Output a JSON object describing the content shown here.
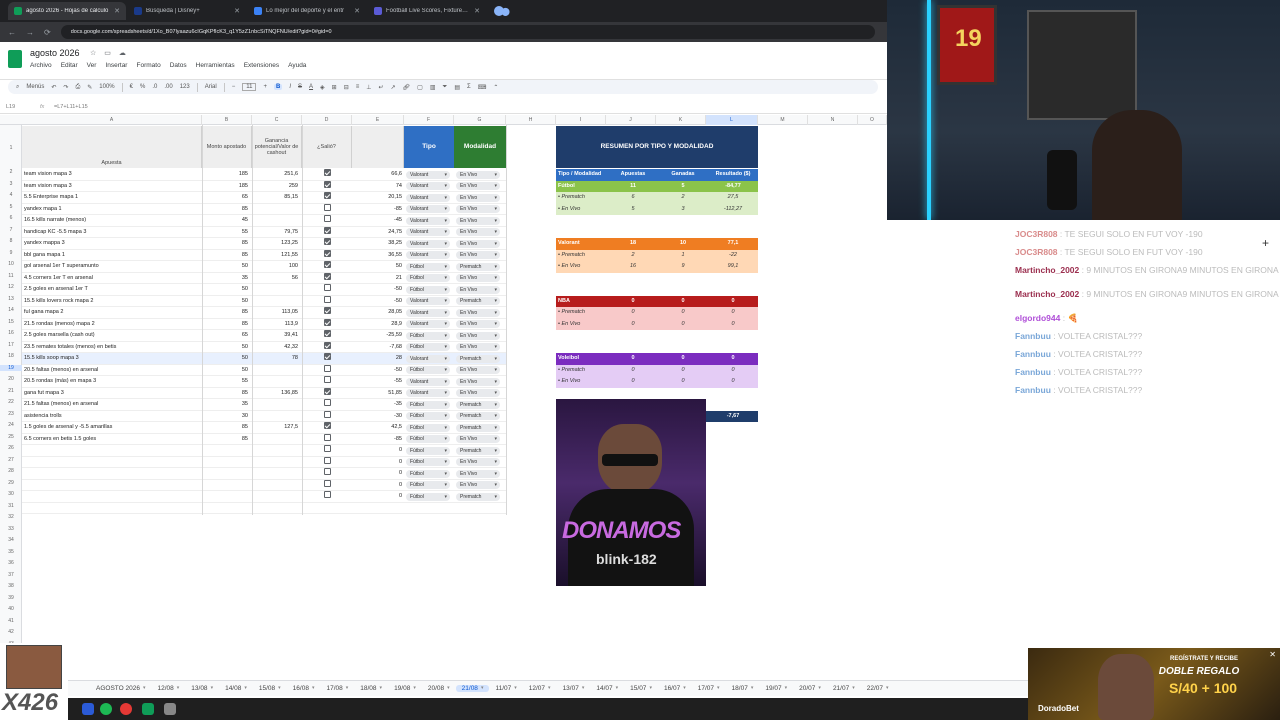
{
  "browser": {
    "tabs": [
      {
        "title": "agosto 2026 - Hojas de cálculo",
        "color": "#0f9d58",
        "active": true
      },
      {
        "title": "Búsqueda | Disney+",
        "color": "#1a3a8a",
        "active": false
      },
      {
        "title": "Lo mejor del deporte y el entr",
        "color": "#3b82f6",
        "active": false
      },
      {
        "title": "Football Live Scores, Fixtures &",
        "color": "#5b5bd6",
        "active": false
      }
    ],
    "url": "docs.google.com/spreadsheets/d/1Xo_B07lyaazu6cIGqKPfIcK3_q1Y5zZ1nbcSiTNQFNU/edit?gid=0#gid=0"
  },
  "sheets": {
    "doc_title": "agosto 2026",
    "menus": [
      "Archivo",
      "Editar",
      "Ver",
      "Insertar",
      "Formato",
      "Datos",
      "Herramientas",
      "Extensiones",
      "Ayuda"
    ],
    "toolbar": {
      "menus_label": "Menús",
      "zoom": "100%",
      "currency": "€",
      "percent": "%",
      "dec_dec": ".0",
      "dec_inc": ".00",
      "num_fmt": "123",
      "font": "Arial",
      "font_size": "11"
    },
    "formula": {
      "name_box": "L19",
      "content": "=L7+L11+L15"
    },
    "columns": [
      "A",
      "B",
      "C",
      "D",
      "E",
      "F",
      "G",
      "H",
      "I",
      "J",
      "K",
      "L",
      "M",
      "N",
      "O"
    ],
    "headers": {
      "apuesta": "Apuesta",
      "monto": "Monto apostado",
      "ganancia": "Ganancia potencial/Valor de cashout",
      "salio": "¿Salió?",
      "tipo": "Tipo",
      "modalidad": "Modalidad"
    },
    "rows": [
      {
        "n": "2",
        "a": "team vision mapa 3",
        "b": "185",
        "c": "251,6",
        "d": true,
        "e": "66,6",
        "f": "Valorant",
        "g": "En Vivo"
      },
      {
        "n": "3",
        "a": "team vision mapa 3",
        "b": "185",
        "c": "259",
        "d": true,
        "e": "74",
        "f": "Valorant",
        "g": "En Vivo"
      },
      {
        "n": "5",
        "a": "5.5 Enterprise mapa 1",
        "b": "65",
        "c": "85,15",
        "d": true,
        "e": "20,15",
        "f": "Valorant",
        "g": "En Vivo"
      },
      {
        "n": "6",
        "a": "yandex mapa 1",
        "b": "85",
        "c": "",
        "d": false,
        "e": "-85",
        "f": "Valorant",
        "g": "En Vivo"
      },
      {
        "n": "7",
        "a": "16.5 kills narrate (menos)",
        "b": "45",
        "c": "",
        "d": false,
        "e": "-45",
        "f": "Valorant",
        "g": "En Vivo"
      },
      {
        "n": "8",
        "a": "handicap KC -5.5 mapa 3",
        "b": "55",
        "c": "79,75",
        "d": true,
        "e": "24,75",
        "f": "Valorant",
        "g": "En Vivo"
      },
      {
        "n": "9",
        "a": "yandex mappa 3",
        "b": "85",
        "c": "123,25",
        "d": true,
        "e": "38,25",
        "f": "Valorant",
        "g": "En Vivo"
      },
      {
        "n": "10",
        "a": "bbl gana mapa 1",
        "b": "85",
        "c": "121,55",
        "d": true,
        "e": "36,55",
        "f": "Valorant",
        "g": "En Vivo"
      },
      {
        "n": "11",
        "a": "gol arsenal 1er T superamunto",
        "b": "50",
        "c": "100",
        "d": true,
        "e": "50",
        "f": "Fútbol",
        "g": "Prematch"
      },
      {
        "n": "12",
        "a": "4.5 corners 1er T en arsenal",
        "b": "35",
        "c": "56",
        "d": true,
        "e": "21",
        "f": "Fútbol",
        "g": "En Vivo"
      },
      {
        "n": "13",
        "a": "2.5 goles en arsenal 1er T",
        "b": "50",
        "c": "",
        "d": false,
        "e": "-50",
        "f": "Fútbol",
        "g": "En Vivo"
      },
      {
        "n": "14",
        "a": "15.5 kills lovers rock mapa 2",
        "b": "50",
        "c": "",
        "d": false,
        "e": "-50",
        "f": "Valorant",
        "g": "Prematch"
      },
      {
        "n": "15",
        "a": "ful gana mapa 2",
        "b": "85",
        "c": "113,05",
        "d": true,
        "e": "28,05",
        "f": "Valorant",
        "g": "En Vivo"
      },
      {
        "n": "16",
        "a": "21.5 rondas (menos) mapa 2",
        "b": "85",
        "c": "113,9",
        "d": true,
        "e": "28,9",
        "f": "Valorant",
        "g": "En Vivo"
      },
      {
        "n": "17",
        "a": "2.5 goles marsella (cash out)",
        "b": "65",
        "c": "39,41",
        "d": true,
        "e": "-25,59",
        "f": "Fútbol",
        "g": "En Vivo"
      },
      {
        "n": "18",
        "a": "23.5 remates totales (menos) en betis",
        "b": "50",
        "c": "42,32",
        "d": true,
        "e": "-7,68",
        "f": "Fútbol",
        "g": "En Vivo"
      },
      {
        "n": "19",
        "a": "15.5 kills soop mapa 3",
        "b": "50",
        "c": "78",
        "d": true,
        "e": "28",
        "f": "Valorant",
        "g": "Prematch"
      },
      {
        "n": "20",
        "a": "20.5 faltas (menos) en arsenal",
        "b": "50",
        "c": "",
        "d": false,
        "e": "-50",
        "f": "Fútbol",
        "g": "En Vivo"
      },
      {
        "n": "21",
        "a": "20.5 rondas (más) en mapa 3",
        "b": "55",
        "c": "",
        "d": false,
        "e": "-55",
        "f": "Valorant",
        "g": "En Vivo"
      },
      {
        "n": "22",
        "a": "gana fut mapa 3",
        "b": "85",
        "c": "136,85",
        "d": true,
        "e": "51,85",
        "f": "Valorant",
        "g": "En Vivo"
      },
      {
        "n": "23",
        "a": "21.5 faltas (menos) en arsenal",
        "b": "35",
        "c": "",
        "d": false,
        "e": "-35",
        "f": "Fútbol",
        "g": "Prematch"
      },
      {
        "n": "24",
        "a": "asistencia trolls",
        "b": "30",
        "c": "",
        "d": false,
        "e": "-30",
        "f": "Fútbol",
        "g": "Prematch"
      },
      {
        "n": "25",
        "a": "1.5 goles de arsenal y -5.5 amarillas",
        "b": "85",
        "c": "127,5",
        "d": true,
        "e": "42,5",
        "f": "Fútbol",
        "g": "Prematch"
      },
      {
        "n": "26",
        "a": "6.5 corners en betis 1.5 goles",
        "b": "85",
        "c": "",
        "d": false,
        "e": "-85",
        "f": "Fútbol",
        "g": "En Vivo"
      },
      {
        "n": "27",
        "a": "",
        "b": "",
        "c": "",
        "d": false,
        "e": "0",
        "f": "Fútbol",
        "g": "Prematch"
      },
      {
        "n": "28",
        "a": "",
        "b": "",
        "c": "",
        "d": false,
        "e": "0",
        "f": "Fútbol",
        "g": "En Vivo"
      },
      {
        "n": "29",
        "a": "",
        "b": "",
        "c": "",
        "d": false,
        "e": "0",
        "f": "Fútbol",
        "g": "En Vivo"
      },
      {
        "n": "30",
        "a": "",
        "b": "",
        "c": "",
        "d": false,
        "e": "0",
        "f": "Fútbol",
        "g": "En Vivo"
      },
      {
        "n": "31",
        "a": "",
        "b": "",
        "c": "",
        "d": false,
        "e": "0",
        "f": "Fútbol",
        "g": "Prematch"
      }
    ],
    "summary": {
      "title": "RESUMEN POR TIPO Y MODALIDAD",
      "headers": [
        "Tipo / Modalidad",
        "Apuestas",
        "Ganadas",
        "Resultado ($)"
      ],
      "rows": [
        {
          "label": "Fútbol",
          "v": [
            "11",
            "5",
            "-84,77"
          ],
          "kind": "futbol-h"
        },
        {
          "label": "• Prematch",
          "v": [
            "6",
            "2",
            "27,5"
          ],
          "kind": "futbol"
        },
        {
          "label": "• En Vivo",
          "v": [
            "5",
            "3",
            "-112,27"
          ],
          "kind": "futbol"
        },
        {
          "label": "Valorant",
          "v": [
            "18",
            "10",
            "77,1"
          ],
          "kind": "val-h"
        },
        {
          "label": "• Prematch",
          "v": [
            "2",
            "1",
            "-22"
          ],
          "kind": "val"
        },
        {
          "label": "• En Vivo",
          "v": [
            "16",
            "9",
            "99,1"
          ],
          "kind": "val"
        },
        {
          "label": "NBA",
          "v": [
            "0",
            "0",
            "0"
          ],
          "kind": "nba-h"
        },
        {
          "label": "• Prematch",
          "v": [
            "0",
            "0",
            "0"
          ],
          "kind": "nba"
        },
        {
          "label": "• En Vivo",
          "v": [
            "0",
            "0",
            "0"
          ],
          "kind": "nba"
        },
        {
          "label": "Voleibol",
          "v": [
            "0",
            "0",
            "0"
          ],
          "kind": "vol-h"
        },
        {
          "label": "• Prematch",
          "v": [
            "0",
            "0",
            "0"
          ],
          "kind": "vol"
        },
        {
          "label": "• En Vivo",
          "v": [
            "0",
            "0",
            "0"
          ],
          "kind": "vol"
        },
        {
          "label": "TOTAL GE",
          "v": [
            "29",
            "15",
            "-7,67"
          ],
          "kind": "total"
        }
      ]
    },
    "sheet_tabs": [
      "AGOSTO 2026",
      "12/08",
      "13/08",
      "14/08",
      "15/08",
      "16/08",
      "17/08",
      "18/08",
      "19/08",
      "20/08",
      "21/08",
      "11/07",
      "12/07",
      "13/07",
      "14/07",
      "15/07",
      "16/07",
      "17/07",
      "18/07",
      "19/07",
      "20/07",
      "21/07",
      "22/07"
    ],
    "active_sheet_tab": "21/08"
  },
  "thumbnail": {
    "line1": "DONAMOS",
    "line2": "blink-182"
  },
  "webcam": {
    "jersey_number": "19"
  },
  "chat": [
    {
      "user": "JOC3R808",
      "msg": "TE SEGUI SOLO EN FUT VOY -190",
      "color": "#d98b8b"
    },
    {
      "user": "JOC3R808",
      "msg": "TE SEGUI SOLO EN FUT VOY -190",
      "color": "#d98b8b"
    },
    {
      "user": "Martincho_2002",
      "msg": "9 MINUTOS EN GIRONA9 MINUTOS EN GIRONA",
      "color": "#9b2f4f"
    },
    {
      "user": "Martincho_2002",
      "msg": "9 MINUTOS EN GIRONA9 MINUTOS EN GIRONA",
      "color": "#9b2f4f"
    },
    {
      "user": "elgordo944",
      "msg": "🍕",
      "color": "#b04fd8"
    },
    {
      "user": "Fannbuu",
      "msg": "VOLTEA CRISTAL???",
      "color": "#7aa7d8"
    },
    {
      "user": "Fannbuu",
      "msg": "VOLTEA CRISTAL???",
      "color": "#7aa7d8"
    },
    {
      "user": "Fannbuu",
      "msg": "VOLTEA CRISTAL???",
      "color": "#7aa7d8"
    },
    {
      "user": "Fannbuu",
      "msg": "VOLTEA CRISTAL???",
      "color": "#7aa7d8"
    }
  ],
  "badge": {
    "label": "X426"
  },
  "ad": {
    "line1": "REGÍSTRATE Y RECIBE",
    "line2": "DOBLE REGALO",
    "line3": "S/40 + 100",
    "brand": "DoradoBet"
  }
}
